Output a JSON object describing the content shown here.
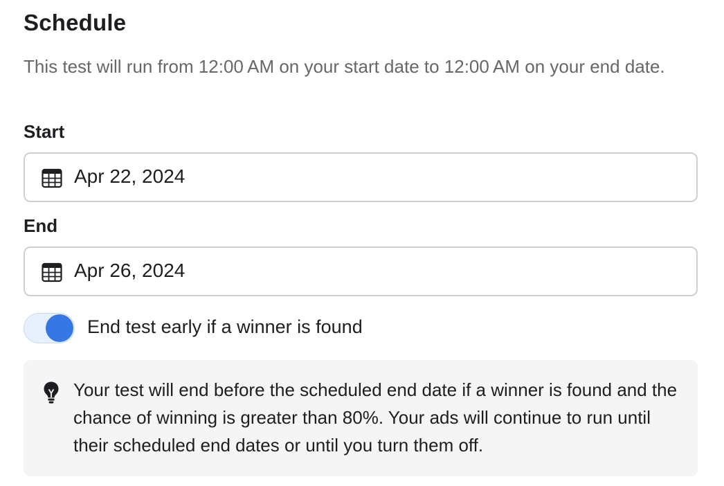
{
  "schedule": {
    "title": "Schedule",
    "description": "This test will run from 12:00 AM on your start date to 12:00 AM on your end date.",
    "start": {
      "label": "Start",
      "value": "Apr 22, 2024",
      "icon": "calendar-icon"
    },
    "end": {
      "label": "End",
      "value": "Apr 26, 2024",
      "icon": "calendar-icon"
    },
    "end_early_toggle": {
      "label": "End test early if a winner is found",
      "checked": true,
      "accent_color": "#3578e5"
    },
    "info": {
      "icon": "lightbulb-icon",
      "text": "Your test will end before the scheduled end date if a winner is found and the chance of winning is greater than 80%. Your ads will continue to run until their scheduled end dates or until you turn them off."
    }
  }
}
